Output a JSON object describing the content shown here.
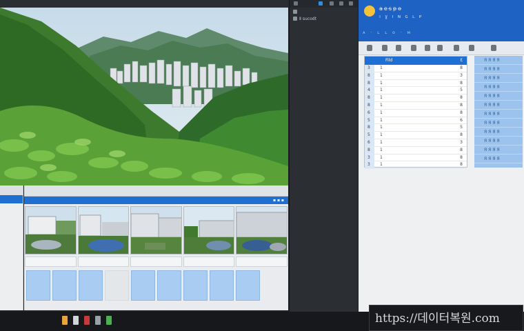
{
  "topbar": {
    "title": ""
  },
  "dark_panel": {
    "label": "Ⅱ sucodt"
  },
  "app": {
    "header_line1": "a̶e̶s̶p̶o̶",
    "header_line2": "ı ɣ ı ɴ ɢ ʟ ᴘ",
    "header_line3": "ᴀ · ʟ ʟ ᴏ · ᴍ",
    "grid_header": {
      "col1": "Fild",
      "col2": "Ɛ"
    },
    "grid_rows": [
      {
        "n": "3",
        "a": "1",
        "b": "8"
      },
      {
        "n": "8",
        "a": "1",
        "b": "3"
      },
      {
        "n": "8",
        "a": "1",
        "b": "8"
      },
      {
        "n": "4",
        "a": "1",
        "b": "5"
      },
      {
        "n": "8",
        "a": "1",
        "b": "8"
      },
      {
        "n": "8",
        "a": "1",
        "b": "8"
      },
      {
        "n": "6",
        "a": "1",
        "b": "8"
      },
      {
        "n": "5",
        "a": "1",
        "b": "6"
      },
      {
        "n": "8",
        "a": "1",
        "b": "5"
      },
      {
        "n": "5",
        "a": "1",
        "b": "8"
      },
      {
        "n": "6",
        "a": "1",
        "b": "3"
      },
      {
        "n": "8",
        "a": "1",
        "b": "8"
      },
      {
        "n": "3",
        "a": "1",
        "b": "8"
      },
      {
        "n": "3",
        "a": "1",
        "b": "8"
      }
    ],
    "side_rows": [
      "ЯЯЯЯ",
      "ЯЯЯЯ",
      "ЯЯЯЯ",
      "ЯЯЯЯ",
      "ЯЯЯЯ",
      "ЯЯЯЯ",
      "ЯЯЯЯ",
      "ЯЯЯЯ",
      "ЯЯЯЯ",
      "ЯЯЯЯ",
      "ЯЯЯЯ",
      "ЯЯЯЯ"
    ]
  },
  "gallery": {
    "bar_left": "",
    "captions": [
      "",
      "",
      "",
      "",
      "",
      "",
      "",
      "",
      "",
      ""
    ]
  },
  "watermark": {
    "text": "https://데이터복원.com"
  },
  "colors": {
    "accent": "#1e6fd0",
    "dark_panel": "#2b2e33",
    "taskbar": "#16181b"
  }
}
